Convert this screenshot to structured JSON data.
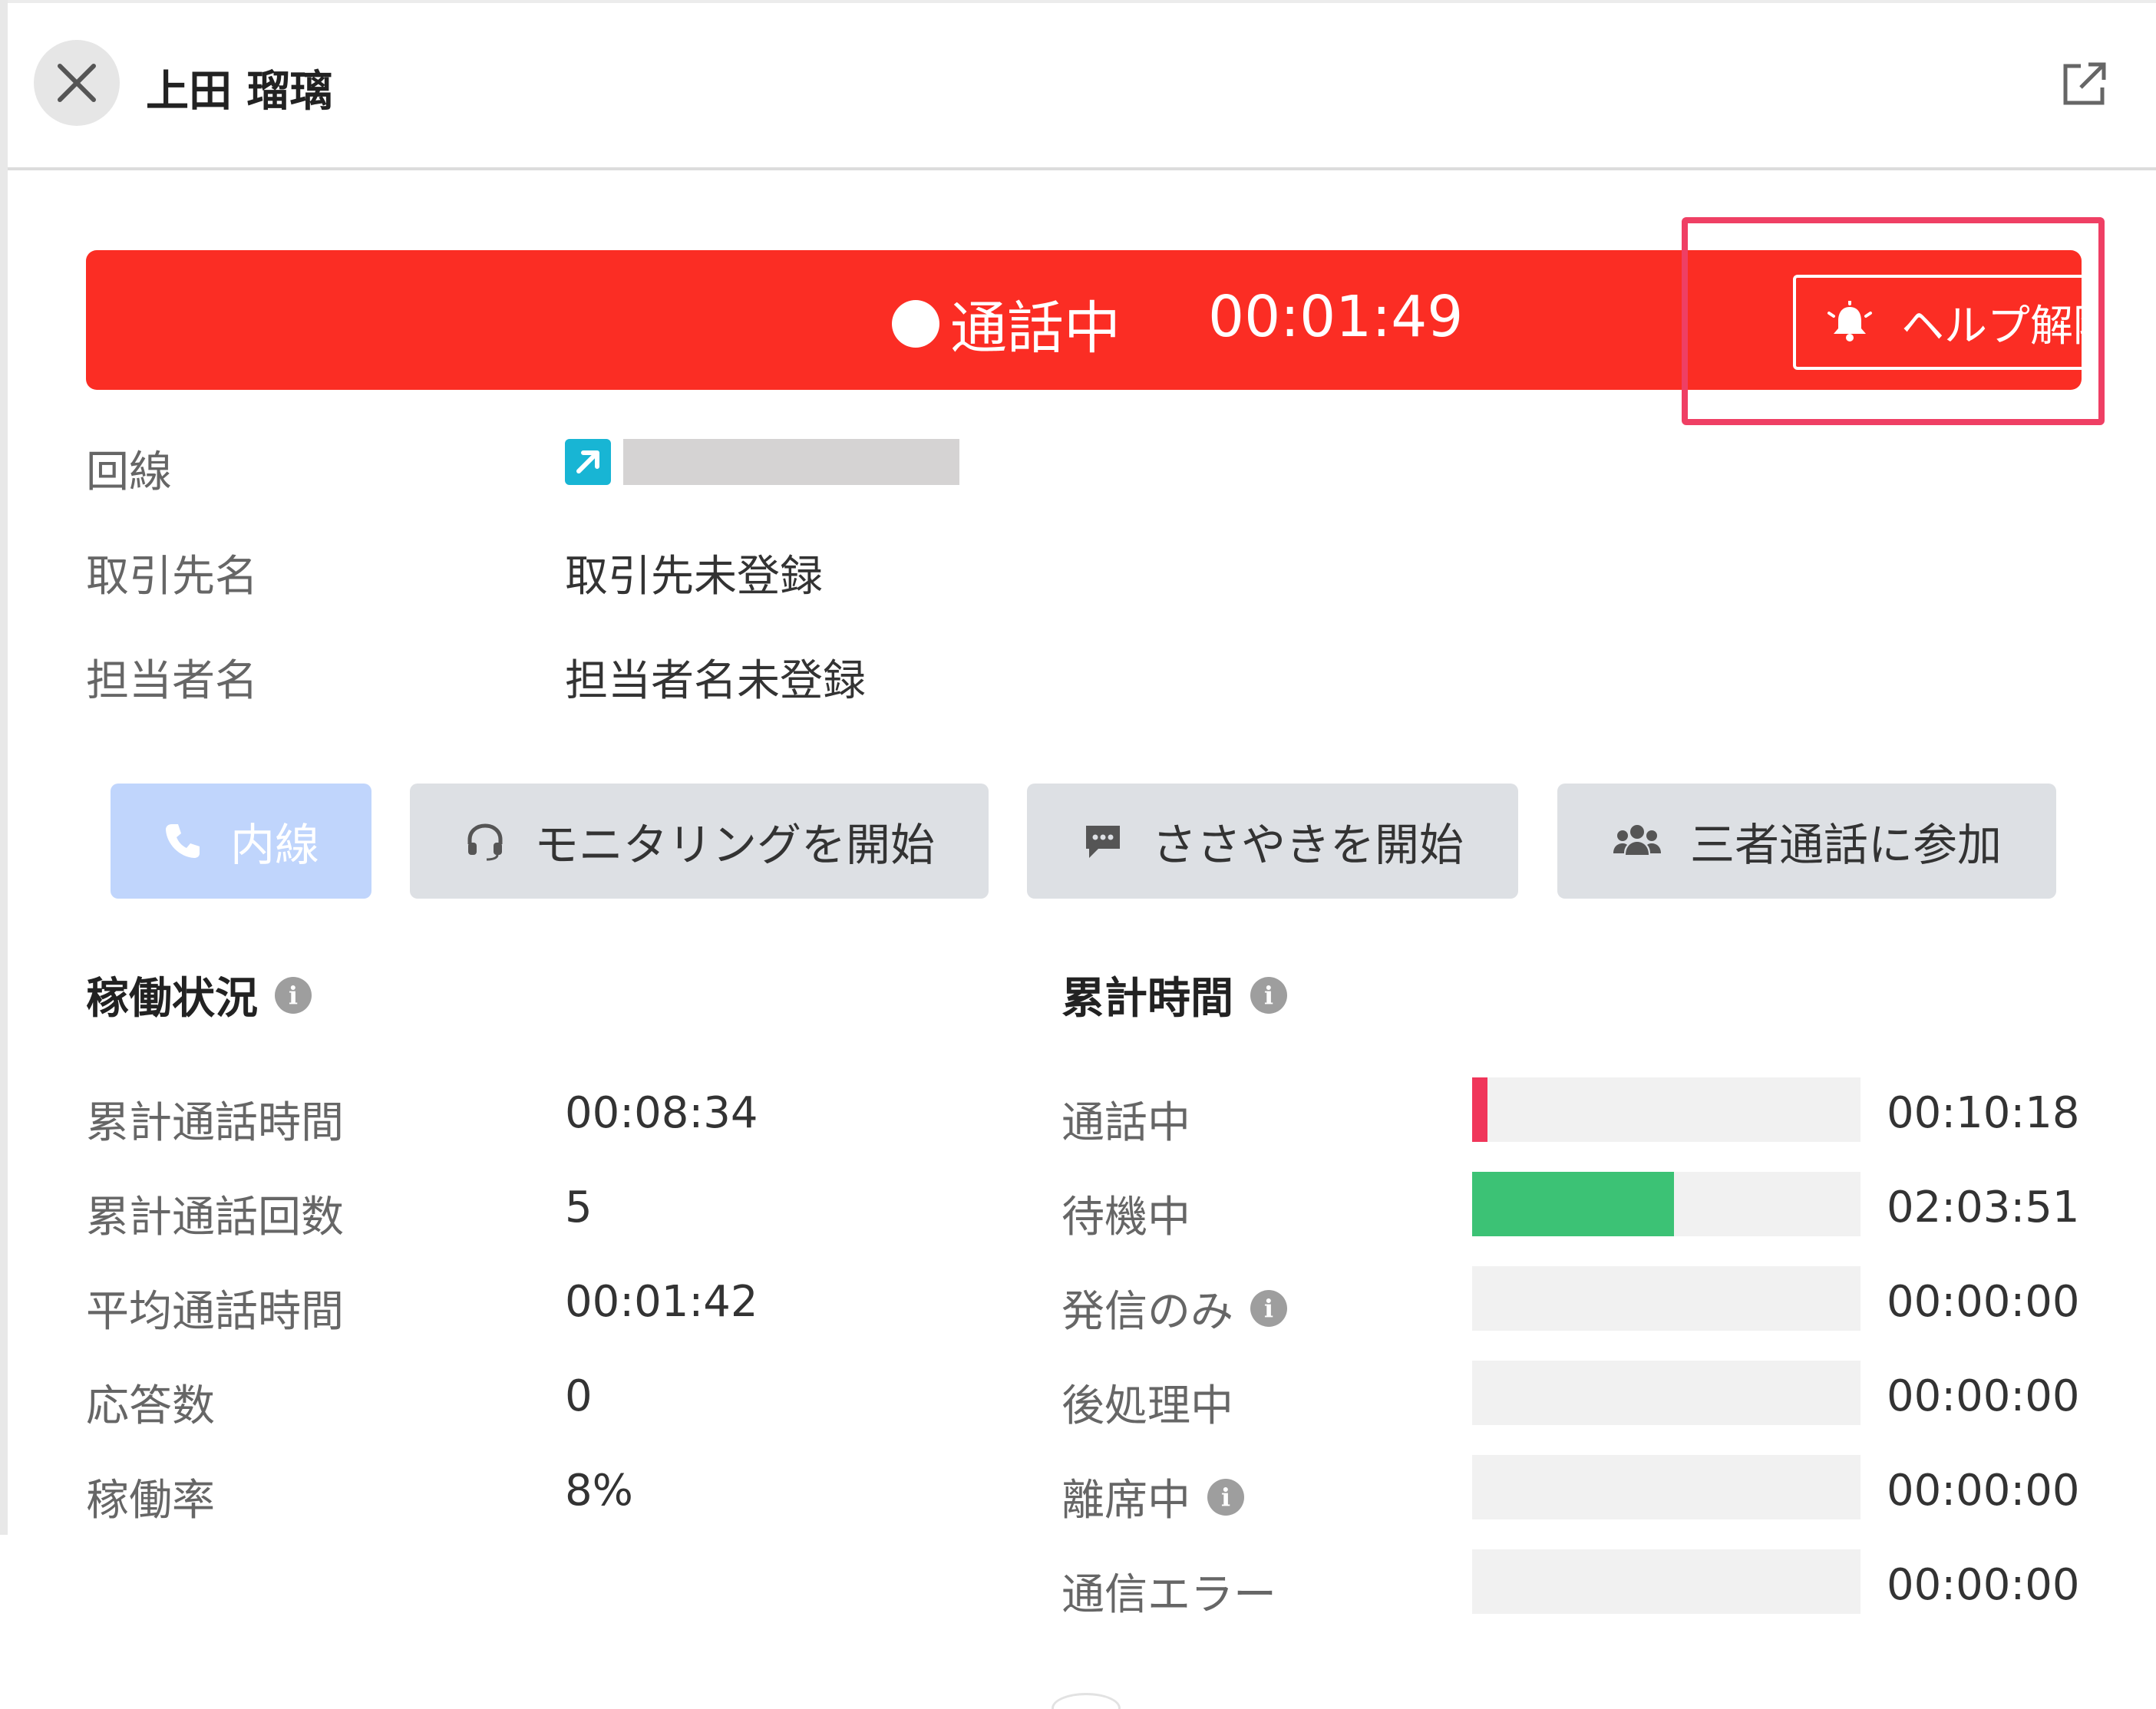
{
  "header": {
    "user_name": "上田 瑠璃",
    "close_icon": "close-icon",
    "popout_icon": "external-link-icon"
  },
  "banner": {
    "status": "通話中",
    "elapsed": "00:01:49",
    "help_button_label": "ヘルプ解除",
    "background_color": "#fb2d24",
    "highlight_color": "#ef3f64"
  },
  "info": {
    "line_label": "回線",
    "client_label": "取引先名",
    "client_value": "取引先未登録",
    "contact_label": "担当者名",
    "contact_value": "担当者名未登録"
  },
  "actions": {
    "extension": "内線",
    "monitoring": "モニタリングを開始",
    "whisper": "ささやきを開始",
    "three_way": "三者通話に参加"
  },
  "operation_status": {
    "title": "稼働状況",
    "rows": [
      {
        "label": "累計通話時間",
        "value": "00:08:34"
      },
      {
        "label": "累計通話回数",
        "value": "5"
      },
      {
        "label": "平均通話時間",
        "value": "00:01:42"
      },
      {
        "label": "応答数",
        "value": "0"
      },
      {
        "label": "稼働率",
        "value": "8%"
      }
    ]
  },
  "cumulative_time": {
    "title": "累計時間",
    "rows": [
      {
        "label": "通話中",
        "value": "00:10:18",
        "fraction": 0.04,
        "color": "#f0365a"
      },
      {
        "label": "待機中",
        "value": "02:03:51",
        "fraction": 0.52,
        "color": "#3cc275"
      },
      {
        "label": "発信のみ",
        "value": "00:00:00",
        "fraction": 0,
        "color": "#cccccc"
      },
      {
        "label": "後処理中",
        "value": "00:00:00",
        "fraction": 0,
        "color": "#cccccc"
      },
      {
        "label": "離席中",
        "value": "00:00:00",
        "fraction": 0,
        "color": "#cccccc"
      },
      {
        "label": "通信エラー",
        "value": "00:00:00",
        "fraction": 0,
        "color": "#cccccc"
      }
    ]
  }
}
